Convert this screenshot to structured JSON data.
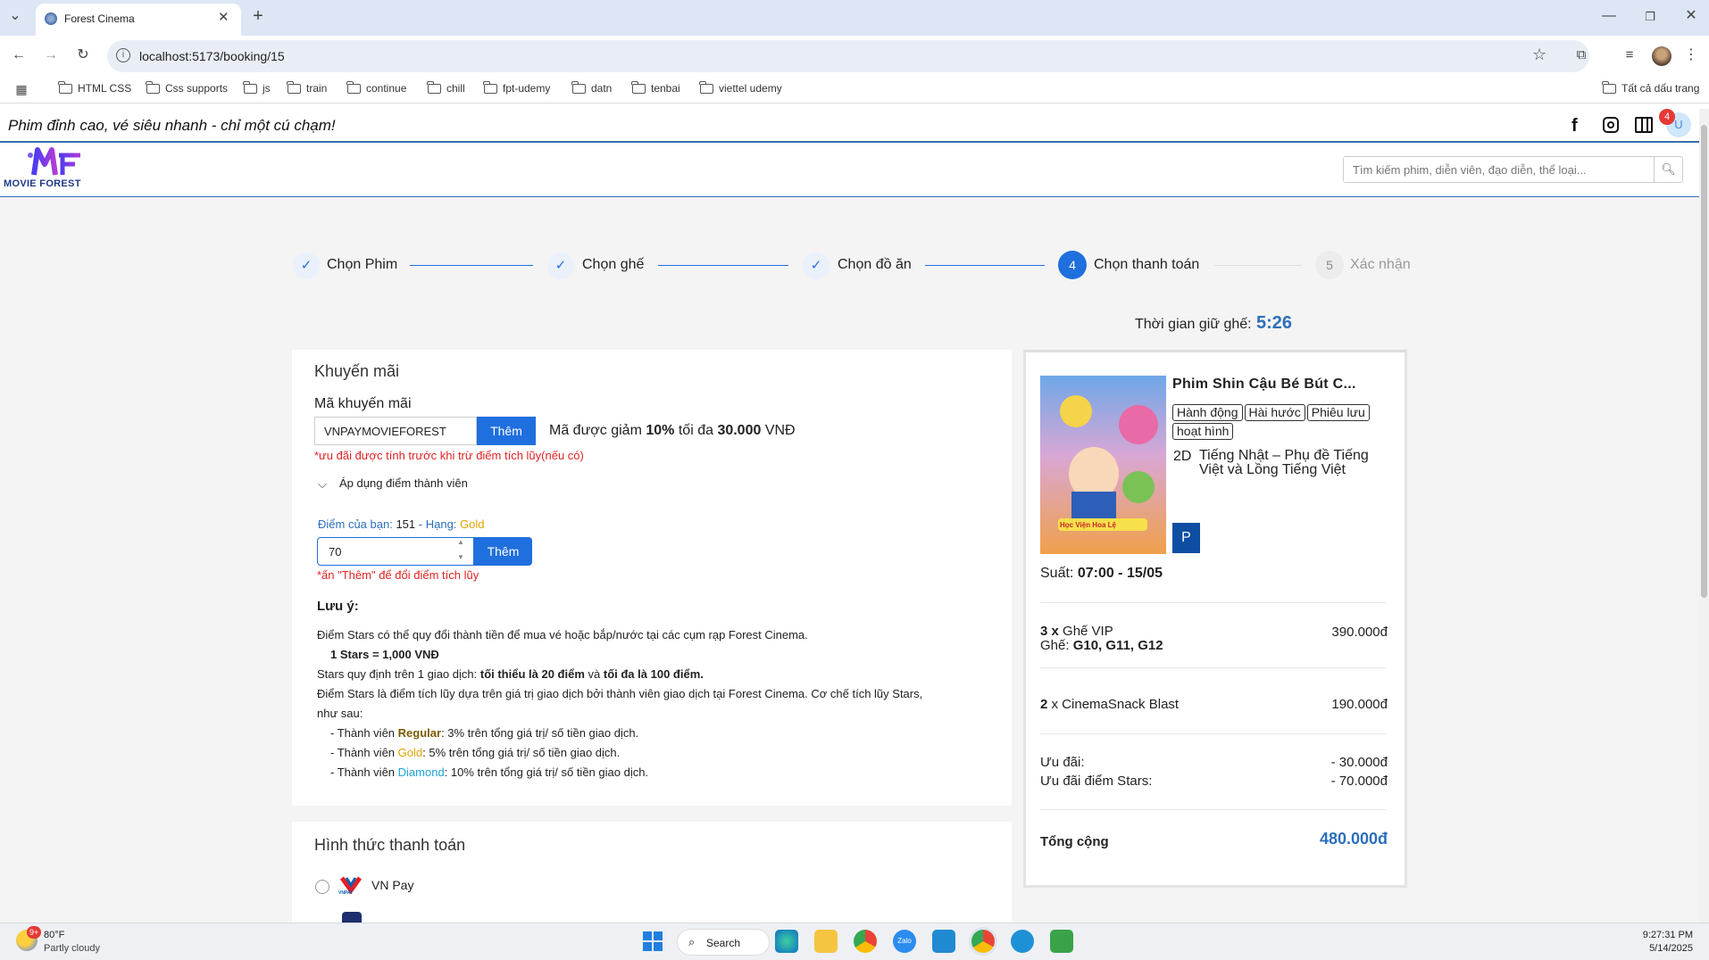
{
  "browser": {
    "tab_title": "Forest Cinema",
    "url": "localhost:5173/booking/15",
    "bookmarks": [
      "HTML CSS",
      "Css supports",
      "js",
      "train",
      "continue",
      "chill",
      "fpt-udemy",
      "datn",
      "tenbai",
      "viettel udemy"
    ],
    "all_bookmarks": "Tất cả dấu trang"
  },
  "site": {
    "tagline": "Phim đỉnh cao, vé siêu nhanh - chỉ một cú chạm!",
    "logo_text": "MOVIE FOREST",
    "search_placeholder": "Tìm kiếm phim, diễn viên, đạo diễn, thể loại...",
    "notification_count": "4",
    "avatar_letter": "U"
  },
  "steps": [
    {
      "label": "Chọn Phim",
      "state": "done"
    },
    {
      "label": "Chọn ghế",
      "state": "done"
    },
    {
      "label": "Chọn đồ ăn",
      "state": "done"
    },
    {
      "label": "Chọn thanh toán",
      "state": "active",
      "number": "4"
    },
    {
      "label": "Xác nhận",
      "state": "pending",
      "number": "5"
    }
  ],
  "hold": {
    "label": "Thời gian giữ ghế:",
    "time": "5:26"
  },
  "promo": {
    "title": "Khuyến mãi",
    "code_label": "Mã khuyến mãi",
    "code_value": "VNPAYMOVIEFOREST",
    "add_btn": "Thêm",
    "discount_prefix": "Mã được giảm",
    "discount_pct": "10%",
    "discount_mid": "tối đa",
    "discount_max": "30.000",
    "discount_unit": "VNĐ",
    "note": "*ưu đãi được tính trước khi trừ điểm tích lũy(nếu có)",
    "member_toggle": "Áp dụng điểm thành viên",
    "points_label": "Điểm của bạn:",
    "points_value": "151",
    "rank_label": "- Hạng:",
    "rank_value": "Gold",
    "points_input": "70",
    "points_btn": "Thêm",
    "points_note": "*ấn \"Thêm\" để đổi điểm tích lũy",
    "notes_title": "Lưu ý:",
    "line1": "Điểm Stars có thể quy đổi thành tiền để mua vé hoặc bắp/nước tại các cụm rạp Forest Cinema.",
    "line2": "1 Stars = 1,000 VNĐ",
    "line3_a": "Stars quy định trên 1 giao dịch:",
    "line3_b": "tối thiểu là 20 điểm",
    "line3_c": "và",
    "line3_d": "tối đa là 100 điểm.",
    "line4": "Điểm Stars là điểm tích lũy dựa trên giá trị giao dịch bởi thành viên giao dịch tại Forest Cinema. Cơ chế tích lũy Stars,",
    "line5": "như sau:",
    "tier_prefix": "- Thành viên",
    "tier1_name": "Regular",
    "tier1_rest": ": 3% trên tổng giá trị/ số tiền giao dịch.",
    "tier2_name": "Gold",
    "tier2_rest": ": 5% trên tổng giá trị/ số tiền giao dịch.",
    "tier3_name": "Diamond",
    "tier3_rest": ": 10% trên tổng giá trị/ số tiền giao dịch."
  },
  "payment": {
    "title": "Hình thức thanh toán",
    "option1": "VN Pay",
    "vnpay_logo": "VNPAY"
  },
  "summary": {
    "movie_title": "Phim Shin Cậu Bé Bút C...",
    "genres": [
      "Hành động",
      "Hài hước",
      "Phiêu lưu",
      "hoạt hình"
    ],
    "format": "2D",
    "language": "Tiếng Nhật – Phụ đề Tiếng Việt và Lồng Tiếng Việt",
    "rating": "P",
    "poster_text": "Học Viện Hoa Lệ",
    "showtime_label": "Suất:",
    "showtime": "07:00 - 15/05",
    "seat_qty": "3 x",
    "seat_type": "Ghế VIP",
    "seat_label": "Ghế:",
    "seats": "G10, G11, G12",
    "seat_price": "390.000đ",
    "snack_qty": "2",
    "snack_name": "x CinemaSnack Blast",
    "snack_price": "190.000đ",
    "discount_label": "Ưu đãi:",
    "discount_value": "- 30.000đ",
    "stars_label": "Ưu đãi điểm Stars:",
    "stars_value": "- 70.000đ",
    "total_label": "Tổng cộng",
    "total_value": "480.000đ"
  },
  "taskbar": {
    "weather_temp": "80°F",
    "weather_desc": "Partly cloudy",
    "weather_badge": "9+",
    "search": "Search",
    "time": "9:27:31 PM",
    "date": "5/14/2025"
  },
  "colors": {
    "accent": "#1f6fde",
    "gold": "#e0a400",
    "diamond": "#1fa3d6",
    "total": "#2c6fbb",
    "warn": "#e02424"
  }
}
